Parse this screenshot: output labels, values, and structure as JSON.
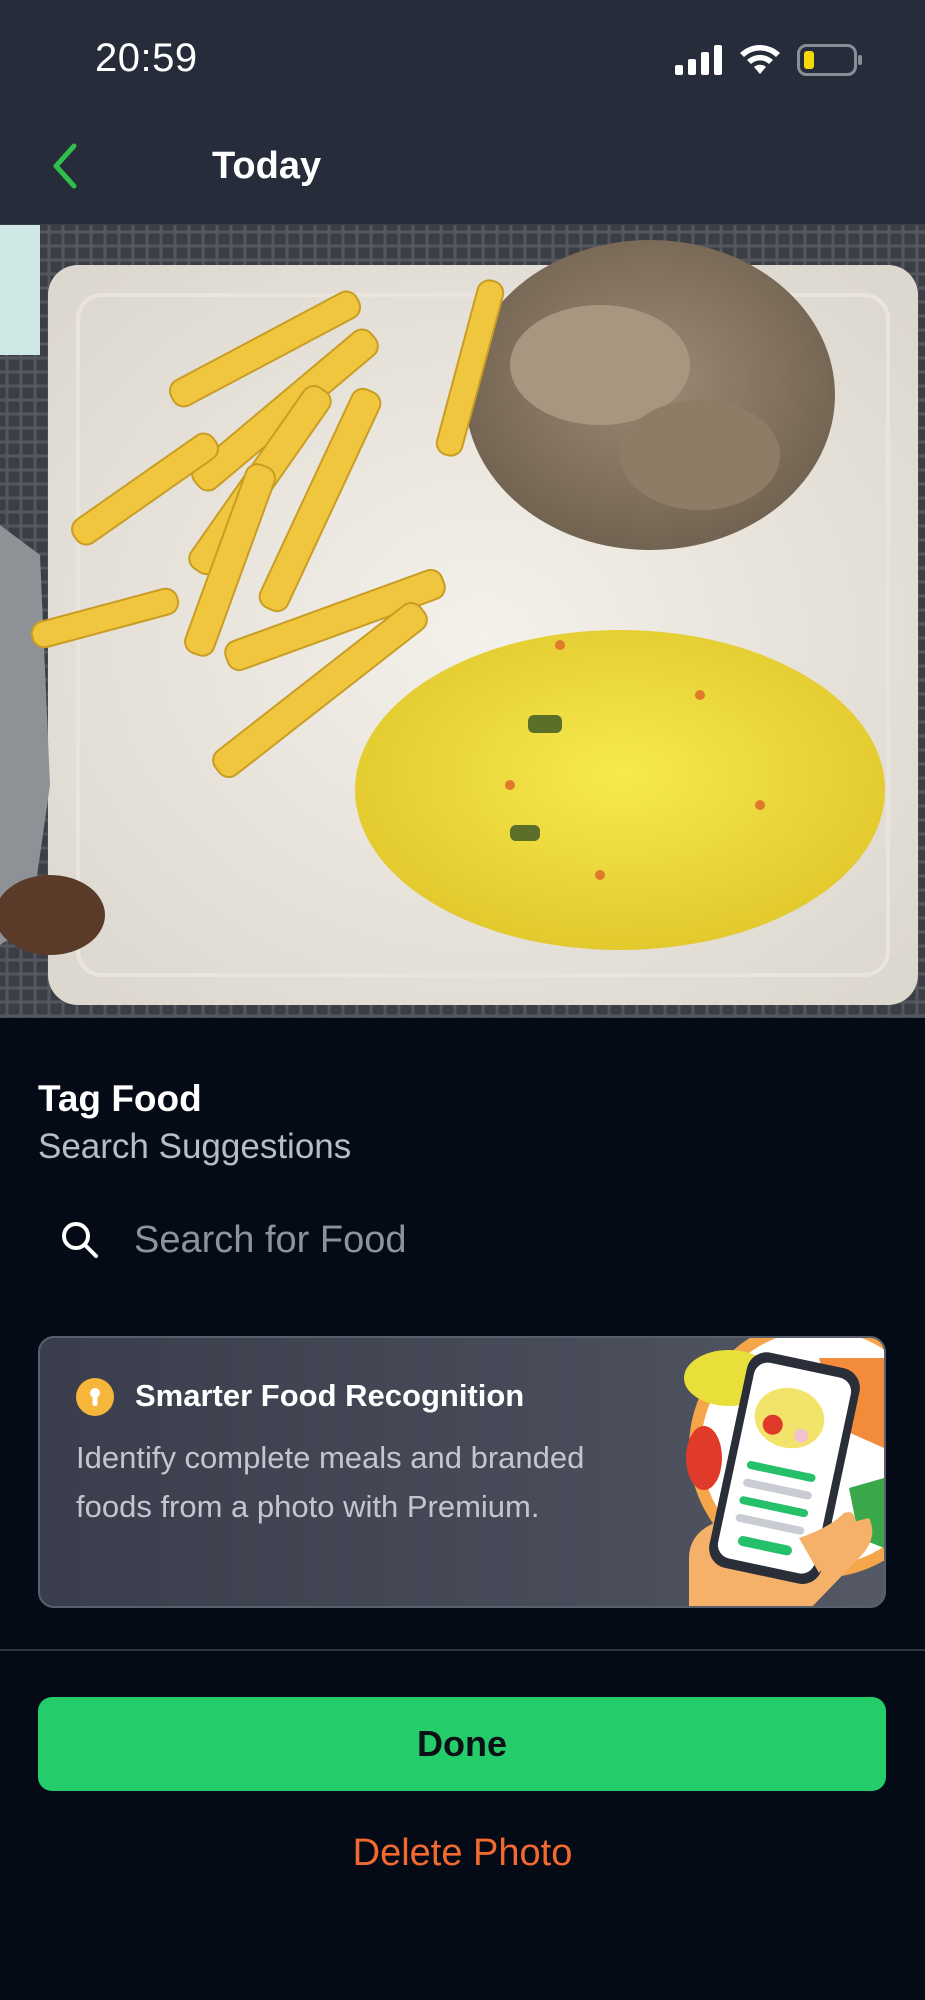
{
  "status_bar": {
    "time": "20:59"
  },
  "nav": {
    "title": "Today"
  },
  "tag": {
    "title": "Tag Food",
    "subtitle": "Search Suggestions"
  },
  "search": {
    "placeholder": "Search for Food"
  },
  "promo": {
    "title": "Smarter Food Recognition",
    "description": "Identify complete meals and branded foods from a photo with Premium."
  },
  "actions": {
    "done": "Done",
    "delete": "Delete Photo"
  },
  "colors": {
    "accent_green": "#25cd6a",
    "delete_orange": "#f26a2e",
    "back_green": "#2fbf4a"
  }
}
